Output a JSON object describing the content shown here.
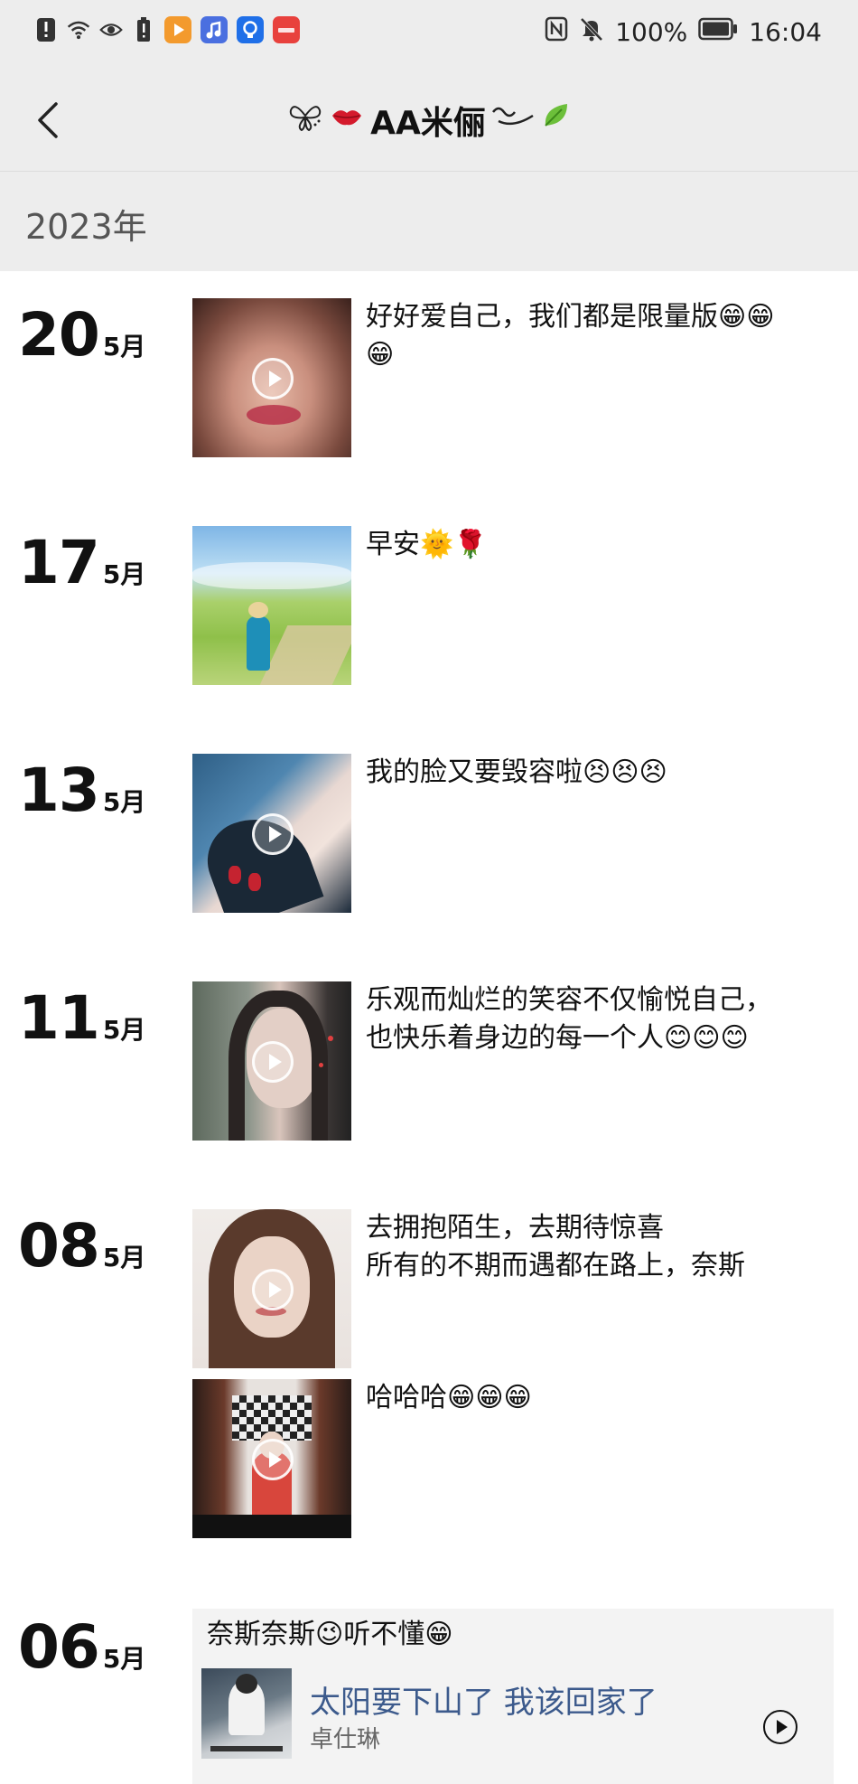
{
  "status_bar": {
    "battery_percent": "100%",
    "time": "16:04"
  },
  "header": {
    "title": "AA米俪"
  },
  "timeline": {
    "year": "2023年",
    "posts": [
      {
        "day": "20",
        "month": "5月",
        "text": "好好爱自己，我们都是限量版😁😁\n😁",
        "media": "video"
      },
      {
        "day": "17",
        "month": "5月",
        "text": "早安🌞🌹",
        "media": "photo"
      },
      {
        "day": "13",
        "month": "5月",
        "text": "我的脸又要毁容啦😣😣😣",
        "media": "video"
      },
      {
        "day": "11",
        "month": "5月",
        "text": "乐观而灿烂的笑容不仅愉悦自己，\n也快乐着身边的每一个人😊😊😊",
        "media": "video"
      },
      {
        "day": "08",
        "month": "5月",
        "text": "去拥抱陌生，去期待惊喜\n所有的不期而遇都在路上，奈斯",
        "media": "video"
      },
      {
        "day": "",
        "month": "",
        "text": "哈哈哈😁😁😁",
        "media": "video"
      }
    ],
    "music_post": {
      "day": "06",
      "month": "5月",
      "text": "奈斯奈斯😉听不懂😁",
      "song_title": "太阳要下山了 我该回家了",
      "artist": "卓仕琳"
    }
  }
}
